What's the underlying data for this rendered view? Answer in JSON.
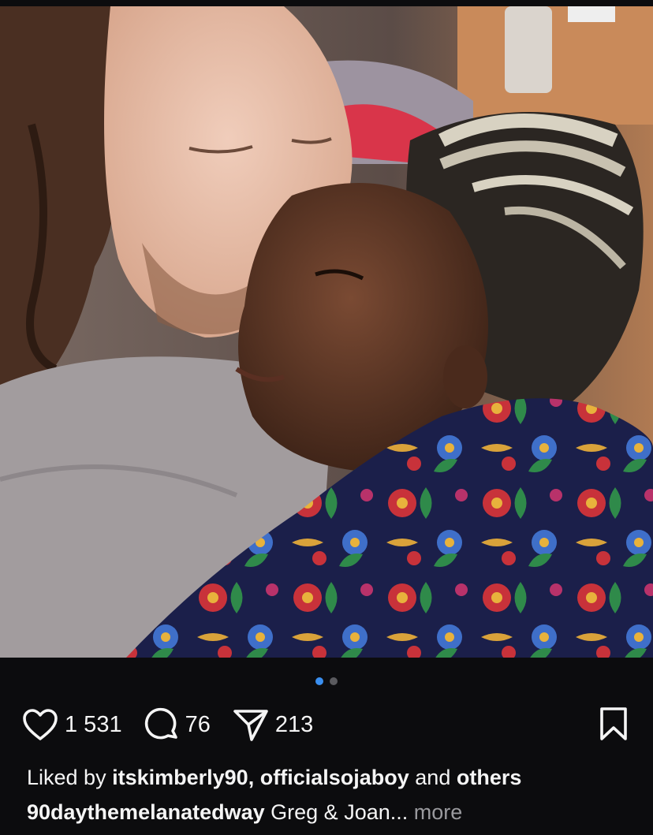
{
  "post": {
    "image_alt": "Couple selfie: man kissing woman's forehead",
    "carousel": {
      "total": 2,
      "active_index": 0
    }
  },
  "actions": {
    "like_icon": "heart-icon",
    "like_count": "1 531",
    "comment_icon": "comment-icon",
    "comment_count": "76",
    "share_icon": "send-icon",
    "share_count": "213",
    "save_icon": "bookmark-icon"
  },
  "likes": {
    "prefix": "Liked by",
    "user1": "itskimberly90,",
    "user2": "officialsojaboy",
    "connector": "and",
    "others": "others"
  },
  "caption": {
    "username": "90daythemelanatedway",
    "text": "Greg & Joan...",
    "more": "more"
  },
  "colors": {
    "background": "#0c0c0e",
    "text": "#f5f5f5",
    "muted": "#9a9a9e",
    "dot_active": "#3a8ff0",
    "dot_inactive": "#5a5a5e"
  }
}
